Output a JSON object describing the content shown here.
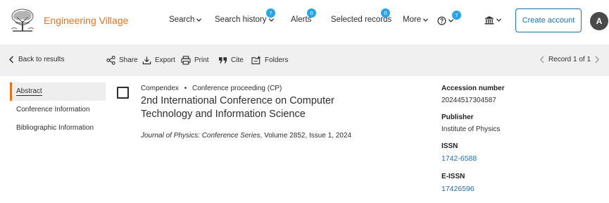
{
  "header": {
    "brand": "Engineering Village",
    "nav": {
      "search": "Search",
      "search_history": "Search history",
      "search_history_count": "7",
      "alerts": "Alerts",
      "alerts_count": "0",
      "selected_records": "Selected records",
      "selected_records_count": "0",
      "more": "More",
      "help_count": "7"
    },
    "create_account": "Create account",
    "avatar_initial": "A"
  },
  "toolbar": {
    "back": "Back to results",
    "share": "Share",
    "export": "Export",
    "print": "Print",
    "cite": "Cite",
    "folders": "Folders",
    "record_position": "Record 1 of 1"
  },
  "leftnav": {
    "items": [
      "Abstract",
      "Conference Information",
      "Bibliographic Information"
    ]
  },
  "record": {
    "database": "Compendex",
    "separator": "•",
    "doc_type": "Conference proceeding (CP)",
    "title": "2nd International Conference on Computer Technology and Information Science",
    "journal": "Journal of Physics: Conference Series",
    "source_rest": ", Volume 2852, Issue 1, 2024"
  },
  "info": {
    "accession_label": "Accession number",
    "accession_value": "20244517304587",
    "publisher_label": "Publisher",
    "publisher_value": "Institute of Physics",
    "issn_label": "ISSN",
    "issn_value": "1742-6588",
    "eissn_label": "E-ISSN",
    "eissn_value": "17426596"
  },
  "icons": {
    "logo": "elsevier-tree-logo",
    "help": "question-circle-icon",
    "institution": "institution-icon"
  },
  "colors": {
    "brand_orange": "#e9711c",
    "link_blue": "#1f6fb5",
    "badge_blue": "#2aa4e8",
    "toolbar_bg": "#f0f0f0"
  }
}
